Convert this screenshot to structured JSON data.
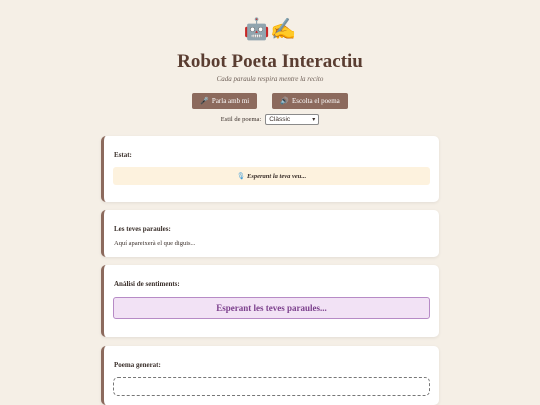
{
  "header": {
    "logo": "🤖✍️",
    "title": "Robot Poeta Interactiu",
    "subtitle": "Cada paraula respira mentre la recito"
  },
  "controls": {
    "speak_icon": "🎤",
    "speak_label": "Parla amb mi",
    "listen_icon": "🔊",
    "listen_label": "Escolta el poema"
  },
  "style": {
    "label": "Estil de poema:",
    "selected": "Clàssic"
  },
  "status": {
    "heading": "Estat:",
    "icon": "🎙",
    "text": "Esperant la teva veu..."
  },
  "words": {
    "heading": "Les teves paraules:",
    "text": "Aquí apareixerà el que diguis..."
  },
  "sentiment": {
    "heading": "Anàlisi de sentiments:",
    "text": "Esperant les teves paraules..."
  },
  "poem": {
    "heading": "Poema generat:"
  }
}
